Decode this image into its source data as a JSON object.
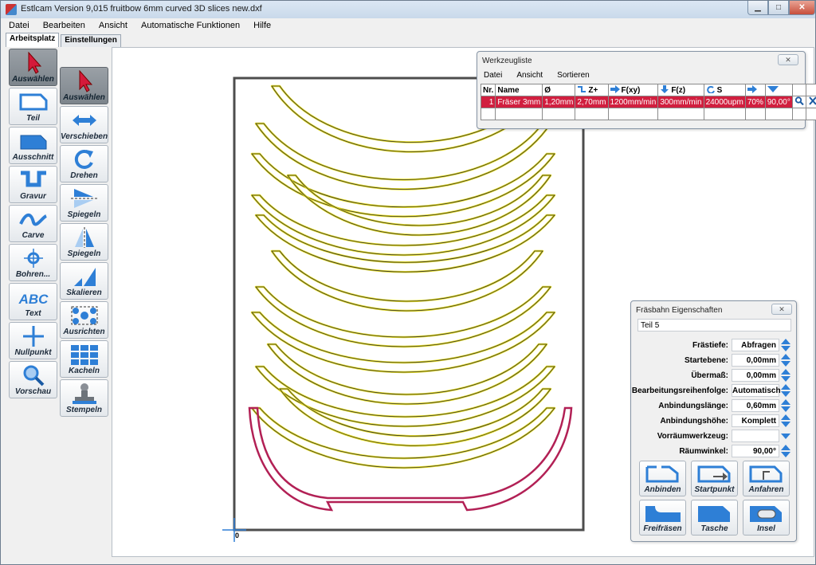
{
  "window": {
    "title": "Estlcam Version 9,015 fruitbow 6mm curved 3D slices new.dxf"
  },
  "menu": [
    "Datei",
    "Bearbeiten",
    "Ansicht",
    "Automatische Funktionen",
    "Hilfe"
  ],
  "tabs": [
    {
      "label": "Arbeitsplatz",
      "active": true
    },
    {
      "label": "Einstellungen",
      "active": false
    }
  ],
  "tools_left": [
    {
      "label": "Auswählen",
      "icon": "cursor-icon",
      "active": true
    },
    {
      "label": "Teil",
      "icon": "part-icon"
    },
    {
      "label": "Ausschnitt",
      "icon": "cutout-icon"
    },
    {
      "label": "Gravur",
      "icon": "engrave-icon"
    },
    {
      "label": "Carve",
      "icon": "carve-icon"
    },
    {
      "label": "Bohren...",
      "icon": "drill-icon"
    },
    {
      "label": "Text",
      "icon": "text-icon",
      "glyph": "ABC"
    },
    {
      "label": "Nullpunkt",
      "icon": "origin-icon"
    },
    {
      "label": "Vorschau",
      "icon": "magnifier-icon"
    }
  ],
  "tools_right": [
    {
      "label": "Auswählen",
      "icon": "cursor-icon",
      "active": true
    },
    {
      "label": "Verschieben",
      "icon": "move-arrows-icon"
    },
    {
      "label": "Drehen",
      "icon": "rotate-icon"
    },
    {
      "label": "Spiegeln",
      "icon": "mirror-horizontal-icon"
    },
    {
      "label": "Spiegeln",
      "icon": "mirror-vertical-icon"
    },
    {
      "label": "Skalieren",
      "icon": "scale-icon"
    },
    {
      "label": "Ausrichten",
      "icon": "align-icon"
    },
    {
      "label": "Kacheln",
      "icon": "tile-icon"
    },
    {
      "label": "Stempeln",
      "icon": "stamp-icon"
    }
  ],
  "canvas": {
    "origin_label": "0"
  },
  "werkzeugliste": {
    "title": "Werkzeugliste",
    "menu": [
      "Datei",
      "Ansicht",
      "Sortieren"
    ],
    "headers": [
      "Nr.",
      "Name",
      "Ø",
      "Z+",
      "F(xy)",
      "F(z)",
      "S",
      "",
      "",
      "",
      ""
    ],
    "row": [
      "1",
      "Fräser 3mm",
      "1,20mm",
      "2,70mm",
      "1200mm/min",
      "300mm/min",
      "24000upm",
      "70%",
      "90,00°"
    ]
  },
  "fraesbahn": {
    "title": "Fräsbahn Eigenschaften",
    "part": "Teil 5",
    "properties": [
      {
        "label": "Frästiefe:",
        "value": "Abfragen"
      },
      {
        "label": "Startebene:",
        "value": "0,00mm"
      },
      {
        "label": "Übermaß:",
        "value": "0,00mm"
      },
      {
        "label": "Bearbeitungsreihenfolge:",
        "value": "Automatisch"
      },
      {
        "label": "Anbindungslänge:",
        "value": "0,60mm"
      },
      {
        "label": "Anbindungshöhe:",
        "value": "Komplett"
      },
      {
        "label": "Vorräumwerkzeug:",
        "value": ""
      },
      {
        "label": "Räumwinkel:",
        "value": "90,00°"
      }
    ],
    "buttons": [
      "Anbinden",
      "Startpunkt",
      "Anfahren",
      "Freifräsen",
      "Tasche",
      "Insel"
    ]
  },
  "colors": {
    "accent": "#2e7fd6",
    "selected_row": "#d11f3f",
    "slice_outline": "#e6dd1e",
    "selected_part": "#b22055"
  }
}
